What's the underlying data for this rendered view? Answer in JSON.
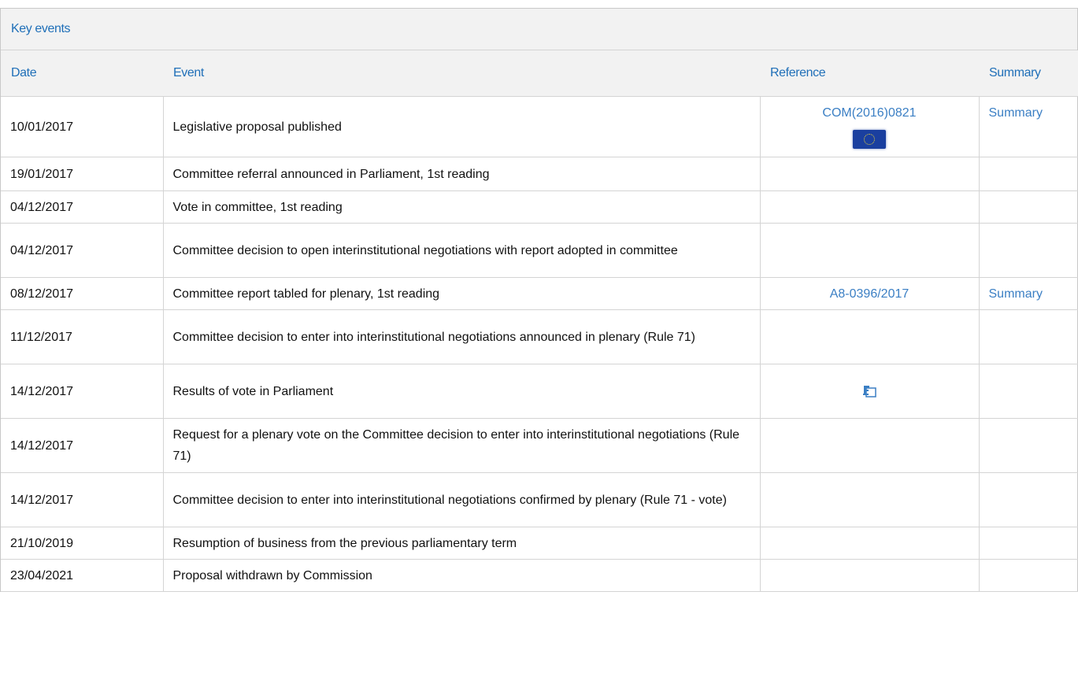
{
  "panel": {
    "title": "Key events"
  },
  "columns": {
    "date": "Date",
    "event": "Event",
    "reference": "Reference",
    "summary": "Summary"
  },
  "rows": [
    {
      "date": "10/01/2017",
      "event": "Legislative proposal published",
      "reference": "COM(2016)0821",
      "reference_icon": "eu-flag-icon",
      "summary": "Summary"
    },
    {
      "date": "19/01/2017",
      "event": "Committee referral announced in Parliament, 1st reading",
      "reference": "",
      "summary": ""
    },
    {
      "date": "04/12/2017",
      "event": "Vote in committee, 1st reading",
      "reference": "",
      "summary": ""
    },
    {
      "date": "04/12/2017",
      "event": "Committee decision to open interinstitutional negotiations with report adopted in committee",
      "reference": "",
      "summary": ""
    },
    {
      "date": "08/12/2017",
      "event": "Committee report tabled for plenary, 1st reading",
      "reference": "A8-0396/2017",
      "summary": "Summary"
    },
    {
      "date": "11/12/2017",
      "event": "Committee decision to enter into interinstitutional negotiations announced in plenary (Rule 71)",
      "reference": "",
      "summary": ""
    },
    {
      "date": "14/12/2017",
      "event": "Results of vote in Parliament",
      "reference": "",
      "reference_icon": "vote-results-icon",
      "summary": ""
    },
    {
      "date": "14/12/2017",
      "event": "Request for a plenary vote on the Committee decision to enter into interinstitutional negotiations (Rule 71)",
      "reference": "",
      "summary": ""
    },
    {
      "date": "14/12/2017",
      "event": "Committee decision to enter into interinstitutional negotiations confirmed by plenary (Rule 71 - vote)",
      "reference": "",
      "summary": ""
    },
    {
      "date": "21/10/2019",
      "event": "Resumption of business from the previous parliamentary term",
      "reference": "",
      "summary": ""
    },
    {
      "date": "23/04/2021",
      "event": "Proposal withdrawn by Commission",
      "reference": "",
      "summary": ""
    }
  ],
  "colors": {
    "link": "#3b7fc4",
    "header_text": "#1f6fb8",
    "header_bg": "#f2f2f2",
    "border": "#d4d4d4"
  }
}
